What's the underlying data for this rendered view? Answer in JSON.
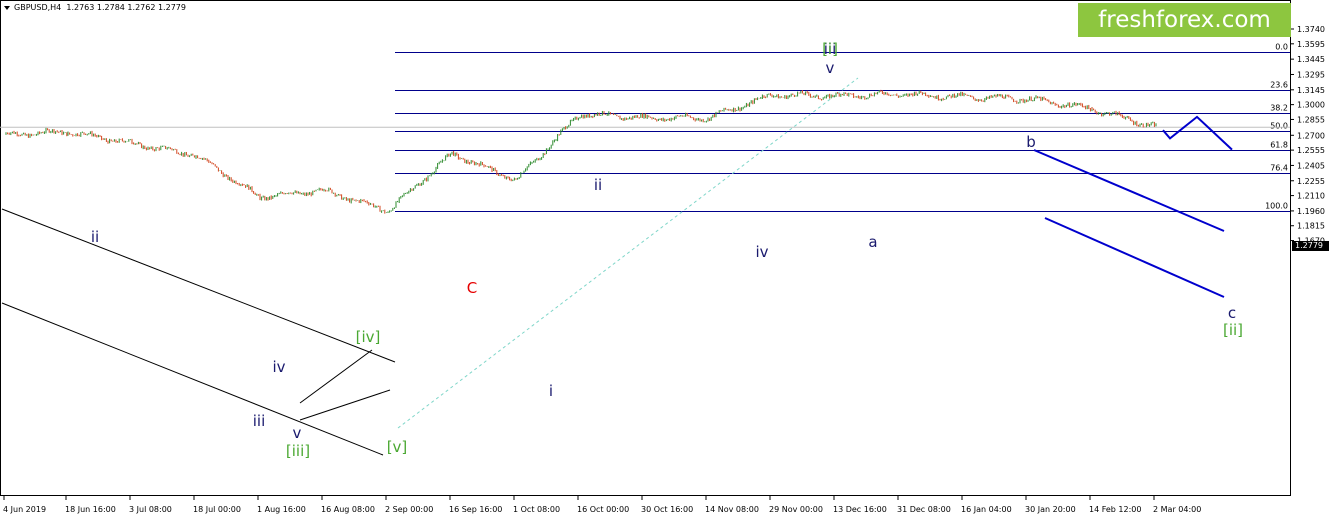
{
  "header": {
    "symbol": "GBPUSD,H4",
    "ohlc": "1.2763 1.2784 1.2762 1.2779"
  },
  "logo": "freshforex.com",
  "current_price_label": "1.2779",
  "colors": {
    "candle_up": "#2e8b2e",
    "candle_down": "#d2451e",
    "fib_line": "#00008b",
    "forecast": "#0000cd",
    "green_label": "#4aa832",
    "red_label": "#e60000",
    "label_dark": "#1a1a6e",
    "channel": "#000000",
    "logo_bg": "#8dc63f"
  },
  "chart_data": {
    "type": "candlestick",
    "ylim": [
      1.1665,
      1.3815
    ],
    "y_ticks": [
      "1.3740",
      "1.3595",
      "1.3445",
      "1.3295",
      "1.3145",
      "1.3000",
      "1.2855",
      "1.2700",
      "1.2555",
      "1.2405",
      "1.2255",
      "1.2110",
      "1.1960",
      "1.1815",
      "1.1670"
    ],
    "x_tick_labels": [
      "4 Jun 2019",
      "18 Jun 16:00",
      "3 Jul 08:00",
      "18 Jul 00:00",
      "1 Aug 16:00",
      "16 Aug 08:00",
      "2 Sep 00:00",
      "16 Sep 16:00",
      "1 Oct 08:00",
      "16 Oct 00:00",
      "30 Oct 16:00",
      "14 Nov 08:00",
      "29 Nov 00:00",
      "13 Dec 16:00",
      "31 Dec 08:00",
      "16 Jan 04:00",
      "30 Jan 20:00",
      "14 Feb 12:00",
      "2 Mar 04:00"
    ],
    "price_path": [
      [
        "4 Jun 2019",
        1.2705
      ],
      [
        "18 Jun 16:00",
        1.2735
      ],
      [
        "3 Jul 08:00",
        1.262
      ],
      [
        "18 Jul 00:00",
        1.2505
      ],
      [
        "1 Aug 16:00",
        1.2095
      ],
      [
        "16 Aug 08:00",
        1.216
      ],
      [
        "2 Sep 00:00",
        1.196
      ],
      [
        "16 Sep 16:00",
        1.252
      ],
      [
        "1 Oct 08:00",
        1.226
      ],
      [
        "16 Oct 00:00",
        1.291
      ],
      [
        "30 Oct 16:00",
        1.287
      ],
      [
        "14 Nov 08:00",
        1.287
      ],
      [
        "29 Nov 00:00",
        1.3095
      ],
      [
        "13 Dec 16:00",
        1.3085
      ],
      [
        "31 Dec 08:00",
        1.3105
      ],
      [
        "16 Jan 04:00",
        1.3075
      ],
      [
        "30 Jan 20:00",
        1.3055
      ],
      [
        "14 Feb 12:00",
        1.296
      ],
      [
        "2 Mar 04:00",
        1.2779
      ]
    ],
    "swing_points": [
      {
        "label": "ii",
        "price": 1.2775
      },
      {
        "label": "iii",
        "price": 1.209
      },
      {
        "label": "iv",
        "price": 1.222
      },
      {
        "label": "v",
        "price": 1.2035
      },
      {
        "label": "[iii]",
        "price": 1.2035
      },
      {
        "label": "[iv]",
        "price": 1.234
      },
      {
        "label": "[v]",
        "price": 1.196
      },
      {
        "label": "C",
        "price": 1.196
      },
      {
        "label": "i",
        "price": 1.258
      },
      {
        "label": "ii",
        "price": 1.2195
      },
      {
        "label": "iii",
        "price": 1.301
      },
      {
        "label": "iv",
        "price": 1.276
      },
      {
        "label": "[i]",
        "price": 1.3515
      },
      {
        "label": "v",
        "price": 1.3515
      },
      {
        "label": "a",
        "price": 1.2905
      },
      {
        "label": "b",
        "price": 1.321
      }
    ],
    "fib_levels": [
      {
        "label": "0.0",
        "price": 1.3515
      },
      {
        "label": "23.6",
        "price": 1.3145
      },
      {
        "label": "38.2",
        "price": 1.2917
      },
      {
        "label": "50.0",
        "price": 1.2738
      },
      {
        "label": "61.8",
        "price": 1.2555
      },
      {
        "label": "76.4",
        "price": 1.2328
      },
      {
        "label": "100.0",
        "price": 1.196
      }
    ],
    "forecast_path": [
      1.275,
      1.267,
      1.288,
      1.256
    ],
    "forecast_labels": [
      "c",
      "[ii]"
    ]
  }
}
